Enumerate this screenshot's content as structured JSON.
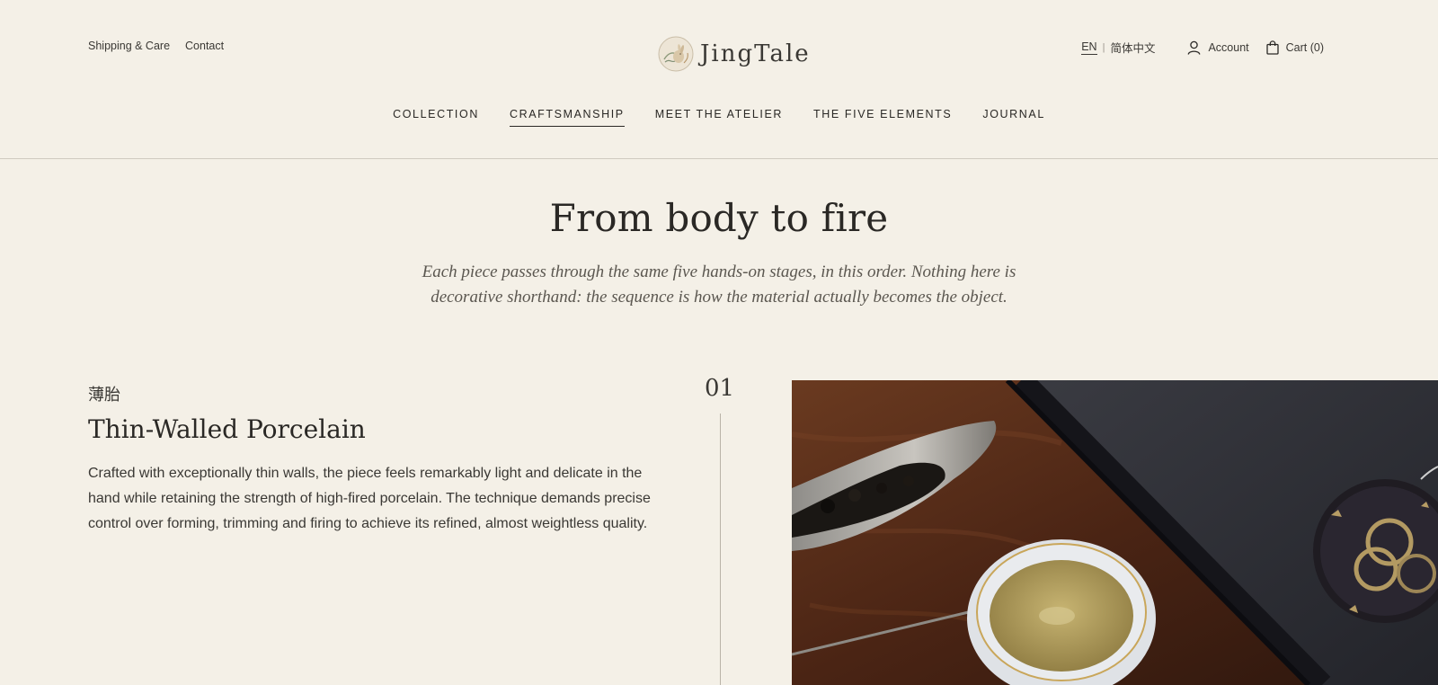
{
  "util_left": {
    "shipping": "Shipping & Care",
    "contact": "Contact"
  },
  "brand": {
    "name": "JingTale"
  },
  "util_right": {
    "lang_en": "EN",
    "lang_sep": "|",
    "lang_zh": "简体中文",
    "account": "Account",
    "cart": "Cart (0)"
  },
  "nav": {
    "items": [
      "COLLECTION",
      "CRAFTSMANSHIP",
      "MEET THE ATELIER",
      "THE FIVE ELEMENTS",
      "JOURNAL"
    ],
    "active": "CRAFTSMANSHIP"
  },
  "intro": {
    "title": "From body to fire",
    "subtitle": "Each piece passes through the same five hands-on stages, in this order. Nothing here is decorative shorthand: the sequence is how the material actually becomes the object."
  },
  "stage": {
    "number": "01",
    "cn": "薄胎",
    "title": "Thin-Walled Porcelain",
    "description": "Crafted with exceptionally thin walls, the piece feels remarkably light and delicate in the hand while retaining the strength of high-fired porcelain. The technique demands precise control over forming, trimming and firing to achieve its refined, almost weightless quality."
  },
  "colors": {
    "background": "#f4f0e7",
    "text": "#2a2825",
    "divider": "#cfcac0"
  },
  "icons": {
    "account": "person-icon",
    "cart": "shopping-bag-icon",
    "logo": "rabbit-emblem-icon"
  }
}
